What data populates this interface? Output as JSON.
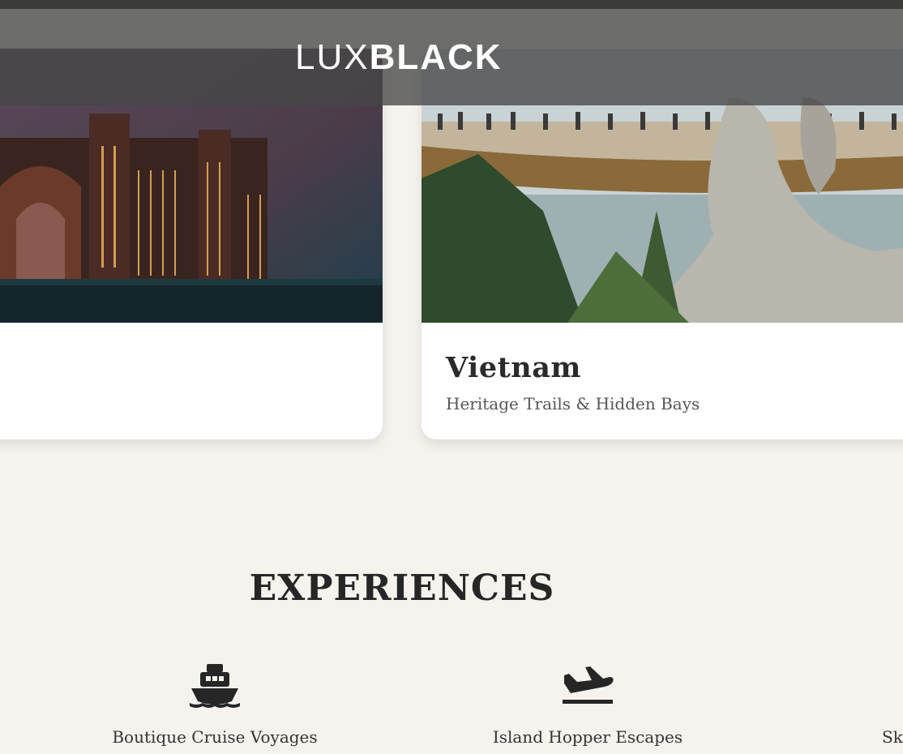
{
  "brand": {
    "logo_light": "LUX",
    "logo_bold": "BLACK"
  },
  "destinations": [
    {
      "title": "",
      "subtitle": "",
      "image_icon": "atlantis-hotel-photo"
    },
    {
      "title": "Vietnam",
      "subtitle": "Heritage Trails & Hidden Bays",
      "image_icon": "golden-bridge-photo"
    }
  ],
  "experiences": {
    "title": "EXPERIENCES",
    "items": [
      {
        "label": "Boutique Cruise Voyages",
        "icon": "ship-icon"
      },
      {
        "label": "Island Hopper Escapes",
        "icon": "plane-landing-icon"
      },
      {
        "label": "Sky",
        "icon": ""
      }
    ]
  },
  "colors": {
    "background": "#f6f3ef",
    "header": "#464646",
    "text_dark": "#262626",
    "text_muted": "#555555"
  }
}
